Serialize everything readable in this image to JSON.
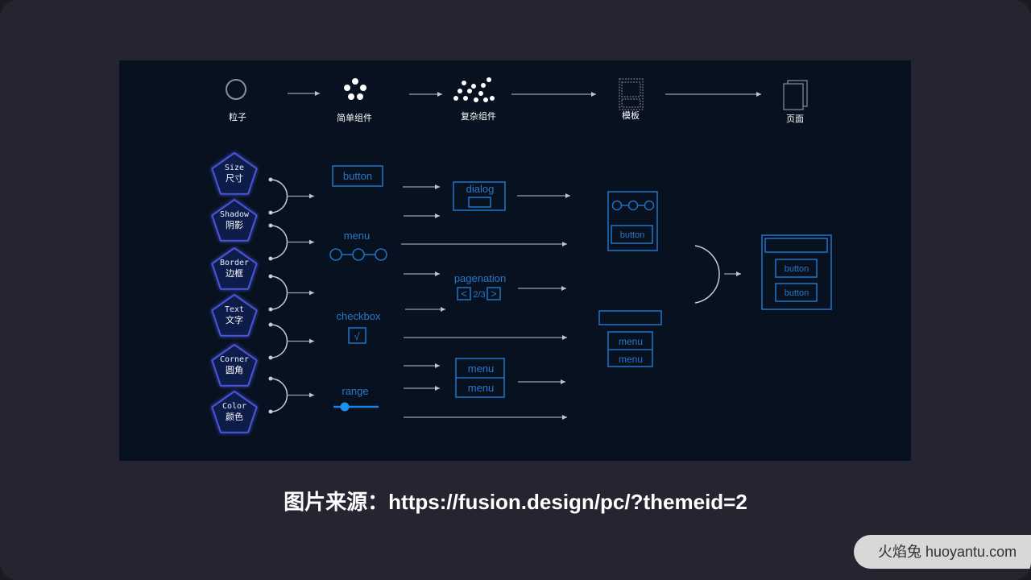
{
  "pipeline": [
    "粒子",
    "简单组件",
    "复杂组件",
    "模板",
    "页面"
  ],
  "attributes": [
    {
      "en": "Size",
      "zh": "尺寸"
    },
    {
      "en": "Shadow",
      "zh": "阴影"
    },
    {
      "en": "Border",
      "zh": "边框"
    },
    {
      "en": "Text",
      "zh": "文字"
    },
    {
      "en": "Corner",
      "zh": "圆角"
    },
    {
      "en": "Color",
      "zh": "颜色"
    }
  ],
  "simple": {
    "button": "button",
    "menu": "menu",
    "checkbox": "checkbox",
    "check_mark": "√",
    "range": "range"
  },
  "complex": {
    "dialog": "dialog",
    "pagenation": "pagenation",
    "prev": "<",
    "page": "2/3",
    "next": ">",
    "menu1": "menu",
    "menu2": "menu"
  },
  "template": {
    "button": "button",
    "menu1": "menu",
    "menu2": "menu"
  },
  "page": {
    "button1": "button",
    "button2": "button"
  },
  "caption": "图片来源：https://fusion.design/pc/?themeid=2",
  "watermark": "火焰兔 huoyantu.com",
  "colors": {
    "background": "#07111f",
    "accent": "#1f6fbf",
    "node_glow": "#4a55d8"
  }
}
